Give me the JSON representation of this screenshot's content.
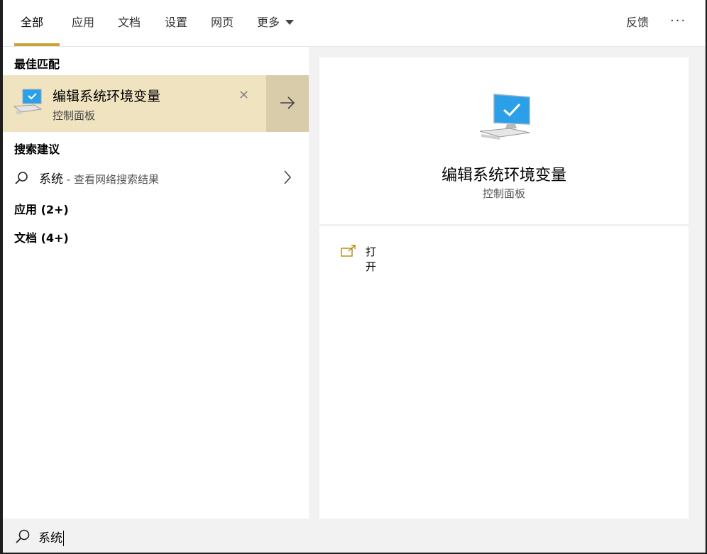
{
  "tabs": [
    {
      "label": "全部",
      "active": true
    },
    {
      "label": "应用",
      "active": false
    },
    {
      "label": "文档",
      "active": false
    },
    {
      "label": "设置",
      "active": false
    },
    {
      "label": "网页",
      "active": false
    },
    {
      "label": "更多",
      "active": false
    }
  ],
  "header": {
    "feedback": "反馈",
    "more": "···"
  },
  "left": {
    "best_match_title": "最佳匹配",
    "best_match": {
      "title": "编辑系统环境变量",
      "subtitle": "控制面板"
    },
    "suggestions_title": "搜索建议",
    "suggestion": {
      "query": "系统",
      "hint": " - 查看网络搜索结果"
    },
    "apps_title": "应用 (2+)",
    "docs_title": "文档 (4+)"
  },
  "preview": {
    "title": "编辑系统环境变量",
    "subtitle": "控制面板",
    "action_open": "打开"
  },
  "search": {
    "value": "系统"
  },
  "colors": {
    "accent": "#c8a430",
    "selected_bg": "#efe3c0",
    "arrow_bg": "#d8ccab",
    "monitor_blue": "#2b9fe8"
  },
  "icons": [
    "control-panel-monitor-icon",
    "search-icon",
    "arrow-right-icon",
    "chevron-right-icon",
    "close-icon",
    "open-external-icon",
    "caret-down-icon"
  ]
}
